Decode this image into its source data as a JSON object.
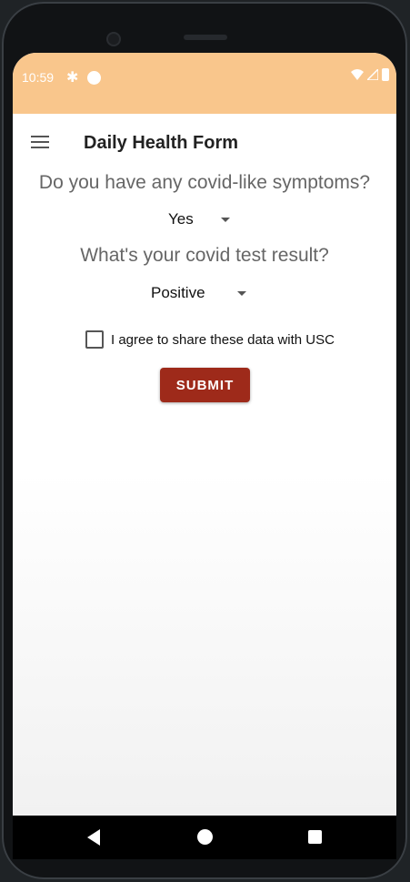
{
  "status_bar": {
    "time": "10:59"
  },
  "app_bar": {
    "title": "Daily Health Form"
  },
  "form": {
    "q1": {
      "label": "Do you have any covid-like symptoms?",
      "selected": "Yes"
    },
    "q2": {
      "label": "What's your covid test result?",
      "selected": "Positive"
    },
    "agree": {
      "label": "I agree to share these data with USC",
      "checked": false
    },
    "submit_label": "SUBMIT"
  },
  "colors": {
    "status_bar": "#f9c68c",
    "submit": "#9e2a1a"
  },
  "icons": [
    "menu-icon",
    "gear-icon",
    "wifi-icon",
    "signal-icon",
    "battery-icon",
    "back-icon",
    "home-icon",
    "recents-icon"
  ]
}
